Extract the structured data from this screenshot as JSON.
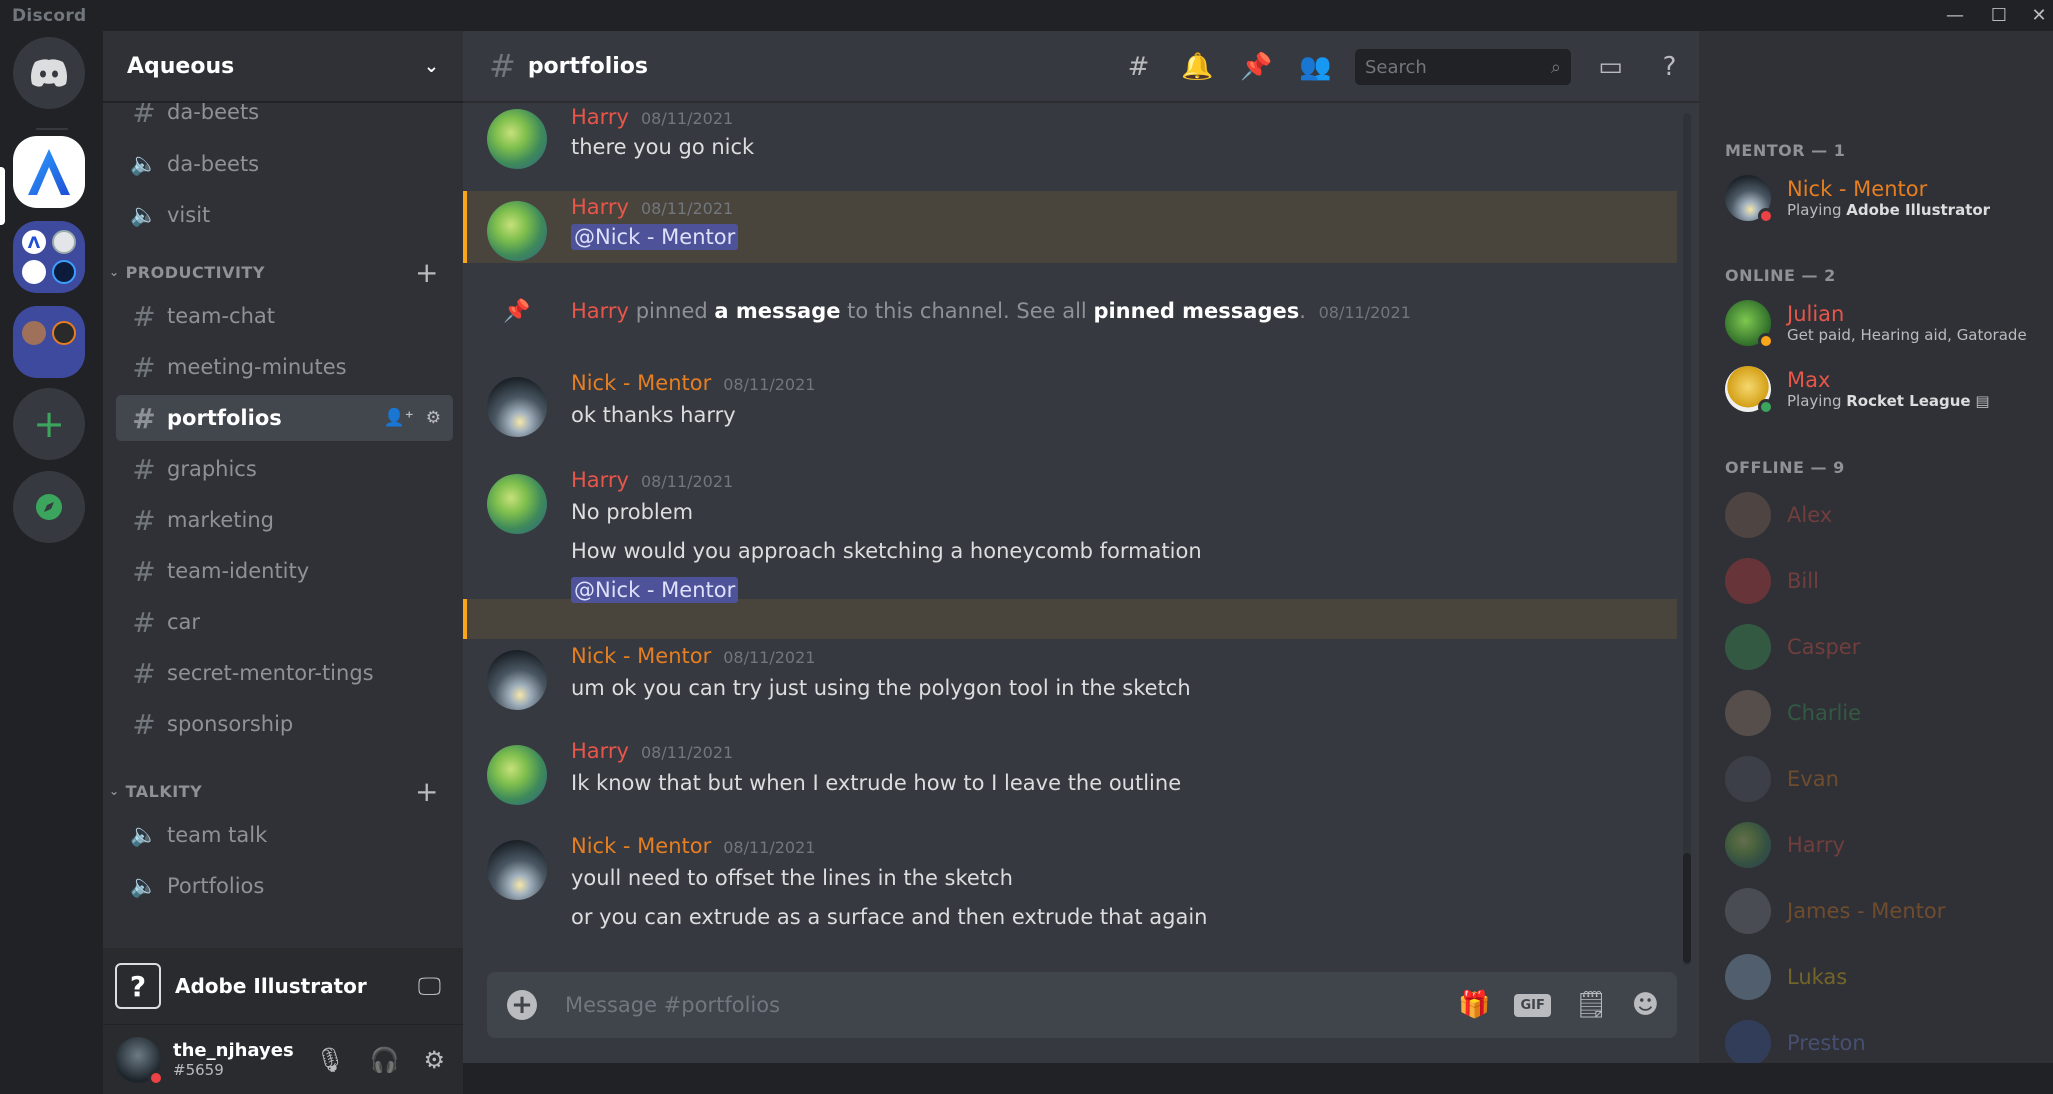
{
  "app": {
    "title": "Discord"
  },
  "guild": {
    "name": "Aqueous"
  },
  "channels": {
    "partial_top": "da-beets",
    "voice_top": [
      {
        "name": "da-beets"
      },
      {
        "name": "visit"
      }
    ],
    "productivity_label": "PRODUCTIVITY",
    "productivity": [
      {
        "name": "team-chat"
      },
      {
        "name": "meeting-minutes"
      },
      {
        "name": "portfolios"
      },
      {
        "name": "graphics"
      },
      {
        "name": "marketing"
      },
      {
        "name": "team-identity"
      },
      {
        "name": "car"
      },
      {
        "name": "secret-mentor-tings"
      },
      {
        "name": "sponsorship"
      }
    ],
    "talkity_label": "TALKITY",
    "talkity": [
      {
        "name": "team talk"
      },
      {
        "name": "Portfolios"
      }
    ]
  },
  "activity": {
    "name": "Adobe Illustrator",
    "icon": "question-mark"
  },
  "user": {
    "name": "the_njhayes",
    "tag": "#5659",
    "status_color": "#ed4245"
  },
  "chat": {
    "channel": "portfolios",
    "search_placeholder": "Search",
    "composer_placeholder": "Message #portfolios",
    "gif_label": "GIF",
    "pin_event": {
      "author": "Harry",
      "text1": "pinned",
      "link1": "a message",
      "text2": "to this channel. See all",
      "link2": "pinned messages",
      "text3": ".",
      "time": "08/11/2021"
    },
    "messages": [
      {
        "author": "Harry",
        "time": "08/11/2021",
        "lines": [
          "there you go nick"
        ]
      },
      {
        "author": "Harry",
        "time": "08/11/2021",
        "mention": "@Nick - Mentor"
      },
      {
        "author": "Nick - Mentor",
        "time": "08/11/2021",
        "lines": [
          "ok thanks harry"
        ]
      },
      {
        "author": "Harry",
        "time": "08/11/2021",
        "lines": [
          "No problem",
          "How would you approach sketching a honeycomb formation"
        ],
        "mention": "@Nick - Mentor"
      },
      {
        "author": "Nick - Mentor",
        "time": "08/11/2021",
        "lines": [
          "um ok you can try just using the polygon tool in the sketch"
        ]
      },
      {
        "author": "Harry",
        "time": "08/11/2021",
        "lines": [
          "Ik know that but when I extrude how to I leave the outline"
        ]
      },
      {
        "author": "Nick - Mentor",
        "time": "08/11/2021",
        "lines": [
          "youll need to offset the lines in the sketch",
          "or you can extrude as a surface and then extrude that again"
        ]
      }
    ]
  },
  "members": {
    "mentor_header": "MENTOR — 1",
    "online_header": "ONLINE — 2",
    "offline_header": "OFFLINE — 9",
    "mentor": [
      {
        "name": "Nick - Mentor",
        "color": "#e67e22",
        "status_prefix": "Playing ",
        "status_bold": "Adobe Illustrator"
      }
    ],
    "online": [
      {
        "name": "Julian",
        "color": "#e8564a",
        "status_prefix": "Get paid, Hearing aid, Gatorade",
        "status_bold": ""
      },
      {
        "name": "Max",
        "color": "#e8564a",
        "status_prefix": "Playing ",
        "status_bold": "Rocket League"
      }
    ],
    "offline": [
      {
        "name": "Alex",
        "color": "#e8564a"
      },
      {
        "name": "Bill",
        "color": "#e8564a"
      },
      {
        "name": "Casper",
        "color": "#e8564a"
      },
      {
        "name": "Charlie",
        "color": "#3ba55d"
      },
      {
        "name": "Evan",
        "color": "#e67e22"
      },
      {
        "name": "Harry",
        "color": "#e8564a"
      },
      {
        "name": "James - Mentor",
        "color": "#e67e22"
      },
      {
        "name": "Lukas",
        "color": "#f1c40f"
      },
      {
        "name": "Preston",
        "color": "#7289da"
      }
    ]
  },
  "colors": {
    "accent": "#5865f2",
    "highlight_border": "#faa61a",
    "mention_bg": "#4e5399"
  }
}
